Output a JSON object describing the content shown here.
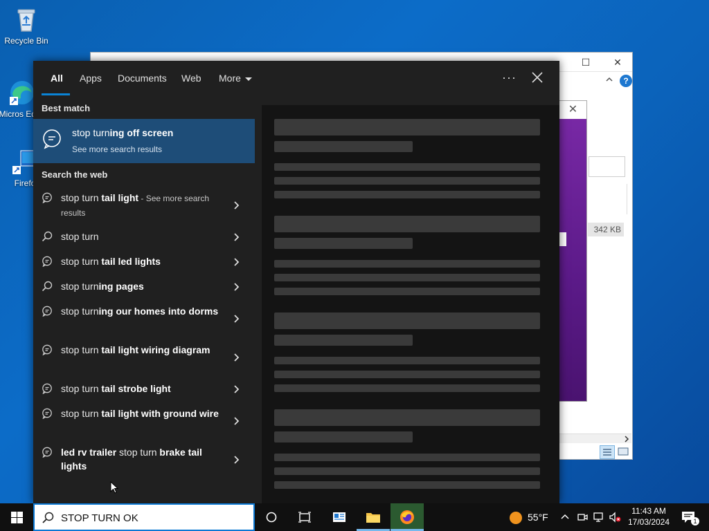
{
  "desktop": {
    "icons": [
      {
        "label": "Recycle Bin"
      },
      {
        "label": "Micros Edge"
      },
      {
        "label": "Firefo"
      }
    ]
  },
  "background_window": {
    "file_size": "342 KB"
  },
  "search_panel": {
    "tabs": [
      {
        "label": "All",
        "active": true
      },
      {
        "label": "Apps"
      },
      {
        "label": "Documents"
      },
      {
        "label": "Web"
      },
      {
        "label": "More"
      }
    ],
    "best_match_heading": "Best match",
    "best_match": {
      "title_plain": "stop turn",
      "title_bold": "ing off screen",
      "subtitle": "See more search results"
    },
    "web_heading": "Search the web",
    "results": [
      {
        "icon": "web-search-icon",
        "plain": "stop turn ",
        "bold": "tail light",
        "extra": " - See more search results"
      },
      {
        "icon": "search-icon",
        "plain": "stop turn",
        "bold": "",
        "extra": ""
      },
      {
        "icon": "web-search-icon",
        "plain": "stop turn ",
        "bold": "tail led lights",
        "extra": ""
      },
      {
        "icon": "search-icon",
        "plain": "stop turn",
        "bold": "ing pages",
        "extra": ""
      },
      {
        "icon": "web-search-icon",
        "plain": "stop turn",
        "bold": "ing our homes into dorms",
        "extra": ""
      },
      {
        "icon": "web-search-icon",
        "plain": "stop turn ",
        "bold": "tail light wiring diagram",
        "extra": ""
      },
      {
        "icon": "web-search-icon",
        "plain": "stop turn ",
        "bold": "tail strobe light",
        "extra": ""
      },
      {
        "icon": "web-search-icon",
        "plain": "stop turn ",
        "bold": "tail light with ground wire",
        "extra": ""
      },
      {
        "icon": "web-search-icon",
        "bold_prefix": "led rv trailer ",
        "plain": "stop turn ",
        "bold": "brake tail lights",
        "extra": ""
      }
    ]
  },
  "taskbar": {
    "search_value": "STOP TURN OK",
    "weather": "55°F",
    "time": "11:43 AM",
    "date": "17/03/2024",
    "notifications": "1"
  },
  "colors": {
    "accent": "#0a78d4",
    "best_match_bg": "#1e4d78",
    "panel_bg": "#202020"
  }
}
